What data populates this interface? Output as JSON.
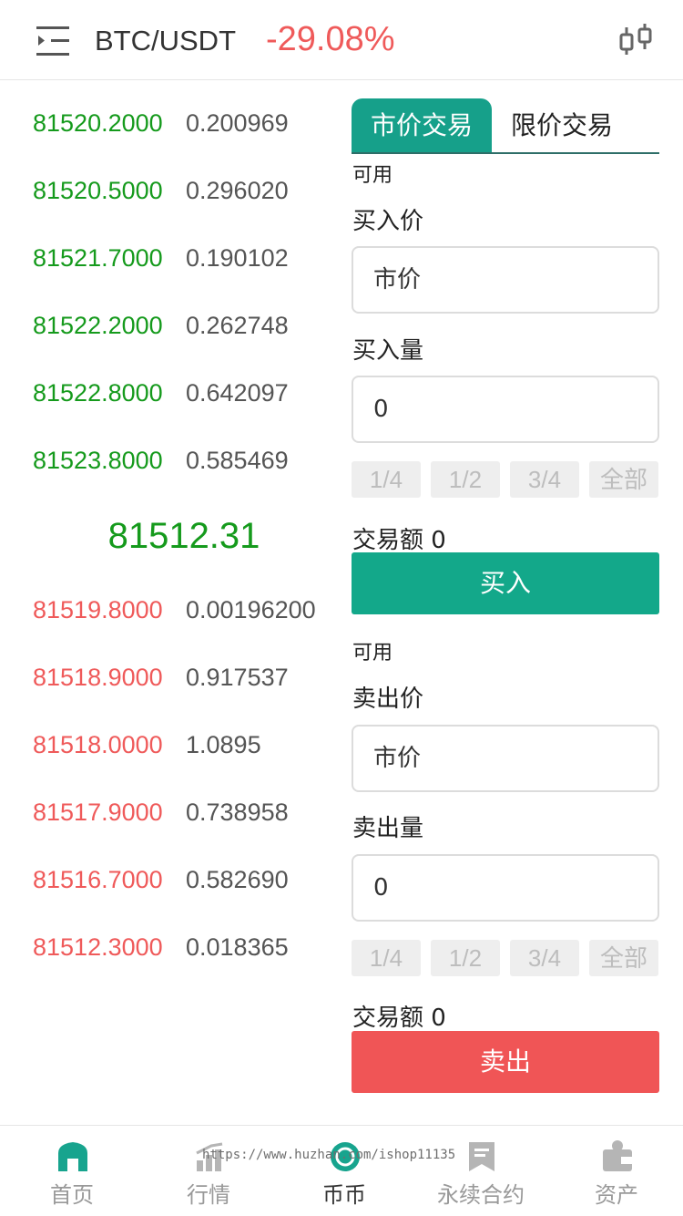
{
  "header": {
    "pair": "BTC/USDT",
    "change": "-29.08%"
  },
  "colors": {
    "ask": "#159a1c",
    "bid": "#ef5a5a",
    "accent": "#16a08a",
    "buy": "#13a88a",
    "sell": "#f05556"
  },
  "orderbook": {
    "asks": [
      {
        "price": "81520.2000",
        "qty": "0.200969"
      },
      {
        "price": "81520.5000",
        "qty": "0.296020"
      },
      {
        "price": "81521.7000",
        "qty": "0.190102"
      },
      {
        "price": "81522.2000",
        "qty": "0.262748"
      },
      {
        "price": "81522.8000",
        "qty": "0.642097"
      },
      {
        "price": "81523.8000",
        "qty": "0.585469"
      }
    ],
    "last_price": "81512.31",
    "bids": [
      {
        "price": "81519.8000",
        "qty": "0.00196200"
      },
      {
        "price": "81518.9000",
        "qty": "0.917537"
      },
      {
        "price": "81518.0000",
        "qty": "1.0895"
      },
      {
        "price": "81517.9000",
        "qty": "0.738958"
      },
      {
        "price": "81516.7000",
        "qty": "0.582690"
      },
      {
        "price": "81512.3000",
        "qty": "0.018365"
      }
    ]
  },
  "tabs": [
    "市价交易",
    "限价交易"
  ],
  "buy": {
    "available_label": "可用",
    "price_label": "买入价",
    "price_value": "市价",
    "qty_label": "买入量",
    "qty_value": "0",
    "percents": [
      "1/4",
      "1/2",
      "3/4",
      "全部"
    ],
    "amount": "交易额 0",
    "button": "买入"
  },
  "sell": {
    "available_label": "可用",
    "price_label": "卖出价",
    "price_value": "市价",
    "qty_label": "卖出量",
    "qty_value": "0",
    "percents": [
      "1/4",
      "1/2",
      "3/4",
      "全部"
    ],
    "amount": "交易额 0",
    "button": "卖出"
  },
  "nav": [
    {
      "label": "首页",
      "icon": "home-icon"
    },
    {
      "label": "行情",
      "icon": "market-icon"
    },
    {
      "label": "币币",
      "icon": "coin-icon"
    },
    {
      "label": "永续合约",
      "icon": "contract-icon"
    },
    {
      "label": "资产",
      "icon": "wallet-icon"
    }
  ],
  "watermark": "https://www.huzhan.com/ishop11135"
}
